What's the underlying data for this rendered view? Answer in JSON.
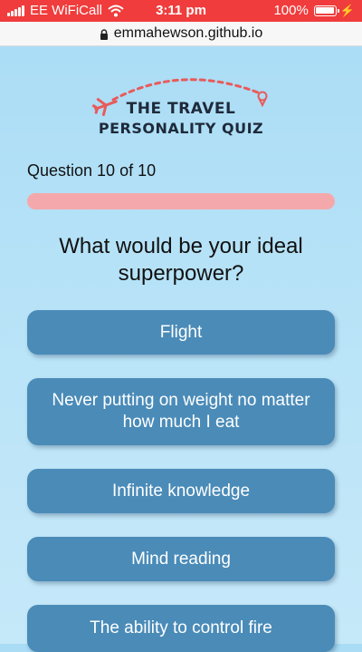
{
  "status_bar": {
    "carrier": "EE WiFiCall",
    "time": "3:11 pm",
    "battery": "100%"
  },
  "browser": {
    "url": "emmahewson.github.io"
  },
  "logo": {
    "line1": "THE TRAVEL",
    "line2": "PERSONALITY QUIZ"
  },
  "quiz": {
    "counter": "Question 10 of 10",
    "progress": 1.0,
    "question": "What would be your ideal superpower?",
    "answers": [
      "Flight",
      "Never putting on weight no matter how much I eat",
      "Infinite knowledge",
      "Mind reading",
      "The ability to control fire"
    ]
  },
  "colors": {
    "status_bar": "#f03c3c",
    "answer_button": "#4a8bb8",
    "progress": "#f5aeb1",
    "logo_accent": "#e85b5b"
  }
}
